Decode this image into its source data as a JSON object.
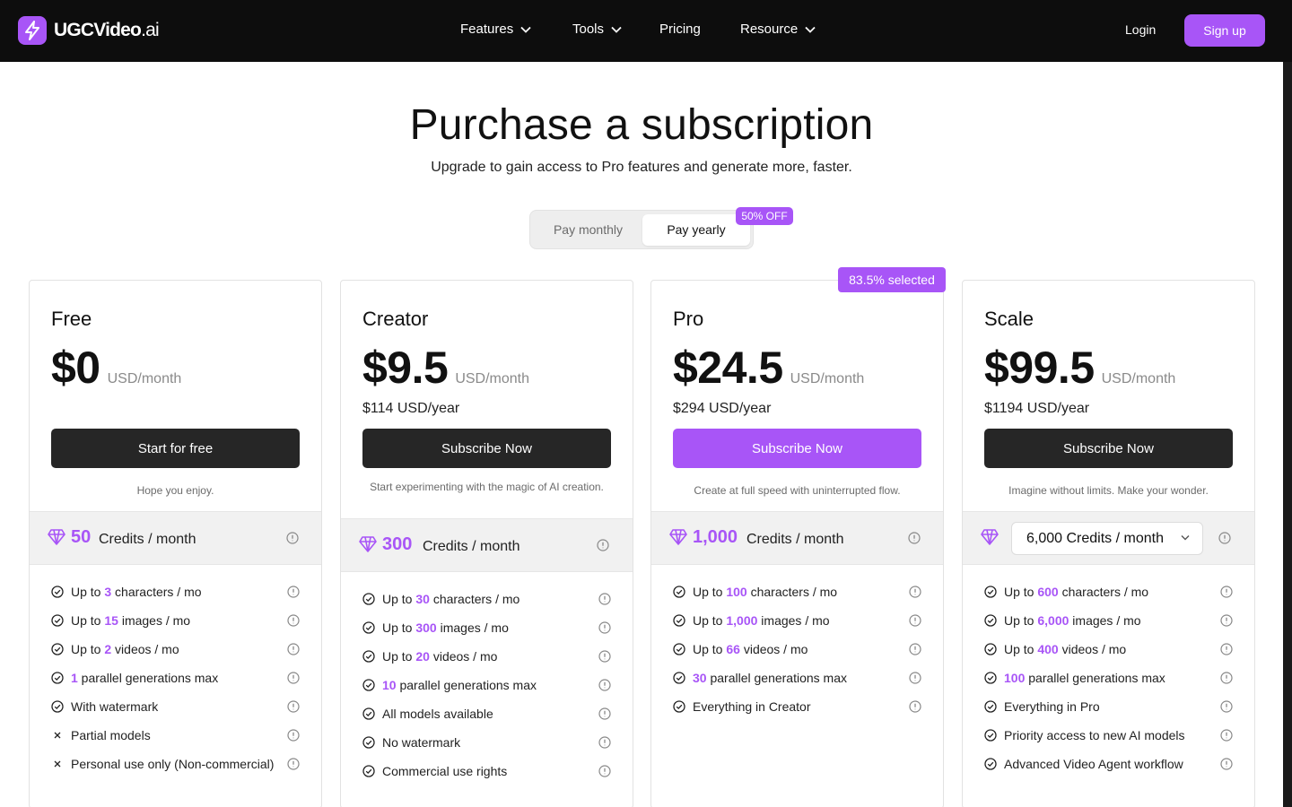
{
  "header": {
    "logo_main": "UGCVideo",
    "logo_suffix": ".ai",
    "nav": [
      {
        "label": "Features",
        "dropdown": true
      },
      {
        "label": "Tools",
        "dropdown": true
      },
      {
        "label": "Pricing",
        "dropdown": false
      },
      {
        "label": "Resource",
        "dropdown": true
      }
    ],
    "login": "Login",
    "signup": "Sign up"
  },
  "page": {
    "title": "Purchase a subscription",
    "subtitle": "Upgrade to gain access to Pro features and generate more, faster."
  },
  "billing_toggle": {
    "monthly": "Pay monthly",
    "yearly": "Pay yearly",
    "selected": "yearly",
    "discount_badge": "50% OFF"
  },
  "colors": {
    "accent": "#a855f7",
    "dark_button": "#262626",
    "header_bg": "#0d0d0d"
  },
  "plans": [
    {
      "name": "Free",
      "price": "$0",
      "unit": "USD/month",
      "yearly": "",
      "cta": "Start for free",
      "tagline": "Hope you enjoy.",
      "credits_amount": "50",
      "credits_label": "Credits / month",
      "features": [
        {
          "icon": "check-circle-icon",
          "pre": "Up to ",
          "hl": "3",
          "post": " characters / mo"
        },
        {
          "icon": "check-circle-icon",
          "pre": "Up to ",
          "hl": "15",
          "post": " images / mo"
        },
        {
          "icon": "check-circle-icon",
          "pre": "Up to ",
          "hl": "2",
          "post": " videos / mo"
        },
        {
          "icon": "check-circle-icon",
          "pre": "",
          "hl": "1",
          "post": " parallel generations max"
        },
        {
          "icon": "check-circle-icon",
          "pre": "With watermark",
          "hl": "",
          "post": ""
        },
        {
          "icon": "x-icon",
          "pre": "Partial models",
          "hl": "",
          "post": ""
        },
        {
          "icon": "x-icon",
          "pre": "Personal use only (Non-commercial)",
          "hl": "",
          "post": ""
        }
      ]
    },
    {
      "name": "Creator",
      "price": "$9.5",
      "unit": "USD/month",
      "yearly": "$114 USD/year",
      "cta": "Subscribe Now",
      "tagline": "Start experimenting with the magic of AI creation.",
      "credits_amount": "300",
      "credits_label": "Credits / month",
      "features": [
        {
          "icon": "check-circle-icon",
          "pre": "Up to ",
          "hl": "30",
          "post": " characters / mo"
        },
        {
          "icon": "check-circle-icon",
          "pre": "Up to ",
          "hl": "300",
          "post": " images / mo"
        },
        {
          "icon": "check-circle-icon",
          "pre": "Up to ",
          "hl": "20",
          "post": " videos / mo"
        },
        {
          "icon": "check-circle-icon",
          "pre": "",
          "hl": "10",
          "post": " parallel generations max"
        },
        {
          "icon": "check-circle-icon",
          "pre": "All models available",
          "hl": "",
          "post": ""
        },
        {
          "icon": "check-circle-icon",
          "pre": "No watermark",
          "hl": "",
          "post": ""
        },
        {
          "icon": "check-circle-icon",
          "pre": "Commercial use rights",
          "hl": "",
          "post": ""
        }
      ]
    },
    {
      "name": "Pro",
      "price": "$24.5",
      "unit": "USD/month",
      "yearly": "$294 USD/year",
      "cta": "Subscribe Now",
      "tagline": "Create at full speed with uninterrupted flow.",
      "badge": "83.5% selected",
      "credits_amount": "1,000",
      "credits_label": "Credits / month",
      "features": [
        {
          "icon": "check-circle-icon",
          "pre": "Up to ",
          "hl": "100",
          "post": " characters / mo"
        },
        {
          "icon": "check-circle-icon",
          "pre": "Up to ",
          "hl": "1,000",
          "post": " images / mo"
        },
        {
          "icon": "check-circle-icon",
          "pre": "Up to ",
          "hl": "66",
          "post": " videos / mo"
        },
        {
          "icon": "check-circle-icon",
          "pre": "",
          "hl": "30",
          "post": " parallel generations max"
        },
        {
          "icon": "check-circle-icon",
          "pre": "Everything in Creator",
          "hl": "",
          "post": ""
        }
      ]
    },
    {
      "name": "Scale",
      "price": "$99.5",
      "unit": "USD/month",
      "yearly": "$1194 USD/year",
      "cta": "Subscribe Now",
      "tagline": "Imagine without limits. Make your wonder.",
      "credits_select": "6,000 Credits / month",
      "features": [
        {
          "icon": "check-circle-icon",
          "pre": "Up to ",
          "hl": "600",
          "post": " characters / mo"
        },
        {
          "icon": "check-circle-icon",
          "pre": "Up to ",
          "hl": "6,000",
          "post": " images / mo"
        },
        {
          "icon": "check-circle-icon",
          "pre": "Up to ",
          "hl": "400",
          "post": " videos / mo"
        },
        {
          "icon": "check-circle-icon",
          "pre": "",
          "hl": "100",
          "post": " parallel generations max"
        },
        {
          "icon": "check-circle-icon",
          "pre": "Everything in Pro",
          "hl": "",
          "post": ""
        },
        {
          "icon": "check-circle-icon",
          "pre": "Priority access to new AI models",
          "hl": "",
          "post": ""
        },
        {
          "icon": "check-circle-icon",
          "pre": "Advanced Video Agent workflow",
          "hl": "",
          "post": ""
        }
      ]
    }
  ]
}
